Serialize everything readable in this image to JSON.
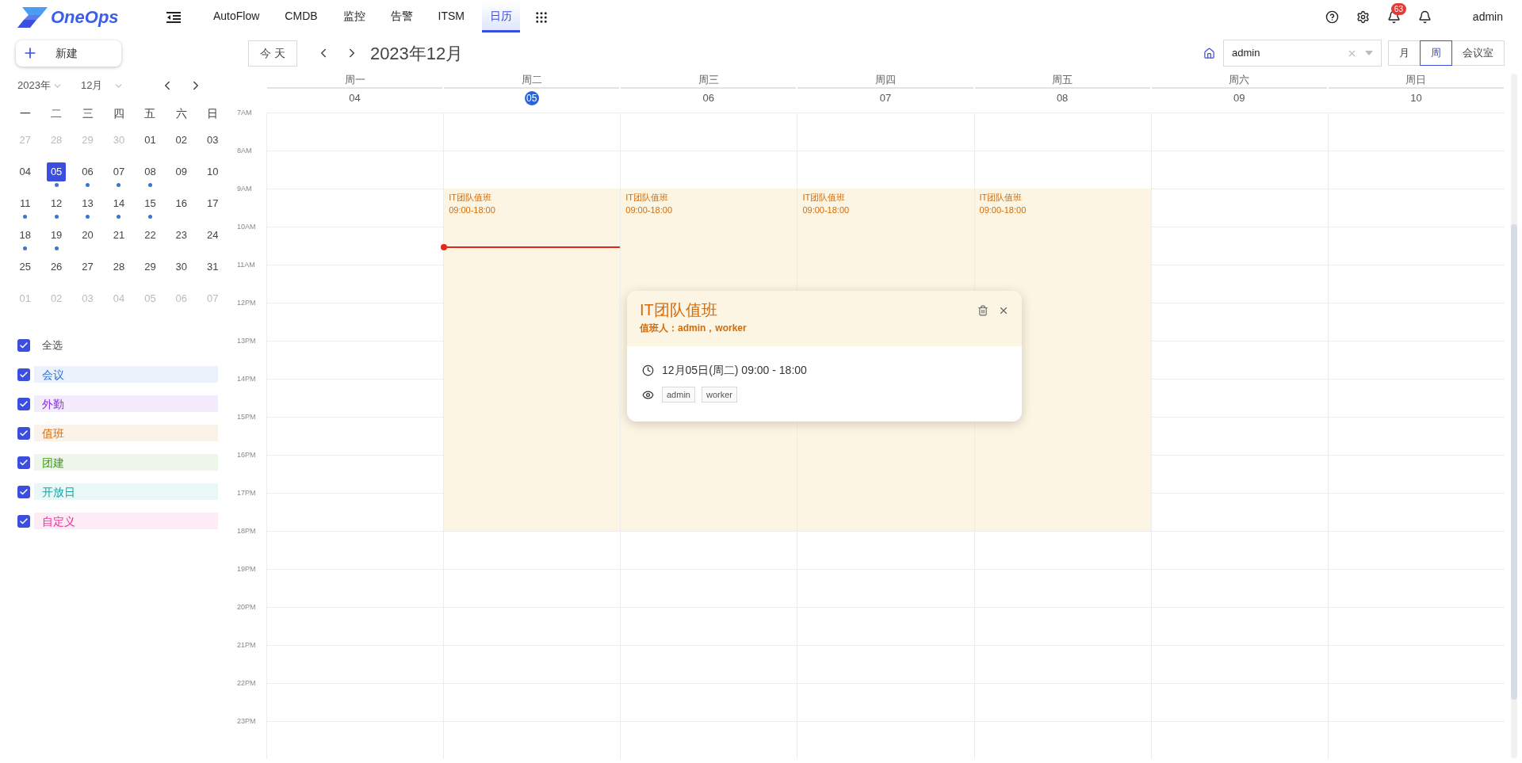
{
  "nav": {
    "logo": "OneOps",
    "menu": [
      {
        "label": "AutoFlow",
        "selected": false
      },
      {
        "label": "CMDB",
        "selected": false
      },
      {
        "label": "监控",
        "selected": false
      },
      {
        "label": "告警",
        "selected": false
      },
      {
        "label": "ITSM",
        "selected": false
      },
      {
        "label": "日历",
        "selected": true
      }
    ],
    "notification_badge": "63",
    "user": "admin"
  },
  "sidebar": {
    "new_button": "新建",
    "year": "2023年",
    "month": "12月",
    "weekdays": [
      "一",
      "二",
      "三",
      "四",
      "五",
      "六",
      "日"
    ],
    "weeks": [
      [
        {
          "day": "27",
          "muted": true,
          "selected": false,
          "dot": false
        },
        {
          "day": "28",
          "muted": true,
          "selected": false,
          "dot": false
        },
        {
          "day": "29",
          "muted": true,
          "selected": false,
          "dot": false
        },
        {
          "day": "30",
          "muted": true,
          "selected": false,
          "dot": false
        },
        {
          "day": "01",
          "muted": false,
          "selected": false,
          "dot": false
        },
        {
          "day": "02",
          "muted": false,
          "selected": false,
          "dot": false
        },
        {
          "day": "03",
          "muted": false,
          "selected": false,
          "dot": false
        }
      ],
      [
        {
          "day": "04",
          "muted": false,
          "selected": false,
          "dot": false
        },
        {
          "day": "05",
          "muted": false,
          "selected": true,
          "dot": true
        },
        {
          "day": "06",
          "muted": false,
          "selected": false,
          "dot": true
        },
        {
          "day": "07",
          "muted": false,
          "selected": false,
          "dot": true
        },
        {
          "day": "08",
          "muted": false,
          "selected": false,
          "dot": true
        },
        {
          "day": "09",
          "muted": false,
          "selected": false,
          "dot": false
        },
        {
          "day": "10",
          "muted": false,
          "selected": false,
          "dot": false
        }
      ],
      [
        {
          "day": "11",
          "muted": false,
          "selected": false,
          "dot": true
        },
        {
          "day": "12",
          "muted": false,
          "selected": false,
          "dot": true
        },
        {
          "day": "13",
          "muted": false,
          "selected": false,
          "dot": true
        },
        {
          "day": "14",
          "muted": false,
          "selected": false,
          "dot": true
        },
        {
          "day": "15",
          "muted": false,
          "selected": false,
          "dot": true
        },
        {
          "day": "16",
          "muted": false,
          "selected": false,
          "dot": false
        },
        {
          "day": "17",
          "muted": false,
          "selected": false,
          "dot": false
        }
      ],
      [
        {
          "day": "18",
          "muted": false,
          "selected": false,
          "dot": true
        },
        {
          "day": "19",
          "muted": false,
          "selected": false,
          "dot": true
        },
        {
          "day": "20",
          "muted": false,
          "selected": false,
          "dot": false
        },
        {
          "day": "21",
          "muted": false,
          "selected": false,
          "dot": false
        },
        {
          "day": "22",
          "muted": false,
          "selected": false,
          "dot": false
        },
        {
          "day": "23",
          "muted": false,
          "selected": false,
          "dot": false
        },
        {
          "day": "24",
          "muted": false,
          "selected": false,
          "dot": false
        }
      ],
      [
        {
          "day": "25",
          "muted": false,
          "selected": false,
          "dot": false
        },
        {
          "day": "26",
          "muted": false,
          "selected": false,
          "dot": false
        },
        {
          "day": "27",
          "muted": false,
          "selected": false,
          "dot": false
        },
        {
          "day": "28",
          "muted": false,
          "selected": false,
          "dot": false
        },
        {
          "day": "29",
          "muted": false,
          "selected": false,
          "dot": false
        },
        {
          "day": "30",
          "muted": false,
          "selected": false,
          "dot": false
        },
        {
          "day": "31",
          "muted": false,
          "selected": false,
          "dot": false
        }
      ],
      [
        {
          "day": "01",
          "muted": true,
          "selected": false,
          "dot": false
        },
        {
          "day": "02",
          "muted": true,
          "selected": false,
          "dot": false
        },
        {
          "day": "03",
          "muted": true,
          "selected": false,
          "dot": false
        },
        {
          "day": "04",
          "muted": true,
          "selected": false,
          "dot": false
        },
        {
          "day": "05",
          "muted": true,
          "selected": false,
          "dot": false
        },
        {
          "day": "06",
          "muted": true,
          "selected": false,
          "dot": false
        },
        {
          "day": "07",
          "muted": true,
          "selected": false,
          "dot": false
        }
      ]
    ],
    "filters": [
      {
        "label": "全选",
        "checked": true
      },
      {
        "label": "会议",
        "checked": true,
        "color": "#2f6fd6"
      },
      {
        "label": "外勤",
        "checked": true,
        "color": "#8a2be2"
      },
      {
        "label": "值班",
        "checked": true,
        "color": "#d46b08"
      },
      {
        "label": "团建",
        "checked": true,
        "color": "#389e0d"
      },
      {
        "label": "开放日",
        "checked": true,
        "color": "#13a8a8"
      },
      {
        "label": "自定义",
        "checked": true,
        "color": "#eb2f96"
      }
    ]
  },
  "toolbar": {
    "today": "今 天",
    "title": "2023年12月",
    "user_select": "admin",
    "views": [
      {
        "label": "月",
        "selected": false
      },
      {
        "label": "周",
        "selected": true
      },
      {
        "label": "会议室",
        "selected": false
      }
    ]
  },
  "week": {
    "hours": [
      "7AM",
      "8AM",
      "9AM",
      "10AM",
      "11AM",
      "12PM",
      "13PM",
      "14PM",
      "15PM",
      "16PM",
      "17PM",
      "18PM",
      "19PM",
      "20PM",
      "21PM",
      "22PM",
      "23PM"
    ],
    "days": [
      {
        "name": "周一",
        "date": "04",
        "today": false
      },
      {
        "name": "周二",
        "date": "05",
        "today": true,
        "now": true,
        "events": [
          {
            "title": "IT团队值班",
            "time": "09:00-18:00"
          }
        ]
      },
      {
        "name": "周三",
        "date": "06",
        "today": false,
        "events": [
          {
            "title": "IT团队值班",
            "time": "09:00-18:00"
          }
        ]
      },
      {
        "name": "周四",
        "date": "07",
        "today": false,
        "events": [
          {
            "title": "IT团队值班",
            "time": "09:00-18:00"
          }
        ]
      },
      {
        "name": "周五",
        "date": "08",
        "today": false,
        "events": [
          {
            "title": "IT团队值班",
            "time": "09:00-18:00"
          }
        ]
      },
      {
        "name": "周六",
        "date": "09",
        "today": false
      },
      {
        "name": "周日",
        "date": "10",
        "today": false
      }
    ]
  },
  "popup": {
    "title": "IT团队值班",
    "subtitle": "值班人：admin，worker",
    "datetime": "12月05日(周二) 09:00 - 18:00",
    "participants": [
      "admin",
      "worker"
    ]
  }
}
